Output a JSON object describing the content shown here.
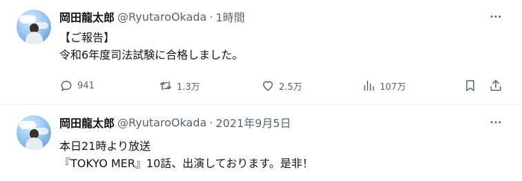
{
  "tweets": [
    {
      "name": "岡田龍太郎",
      "handle": "@RyutaroOkada",
      "separator": "·",
      "time": "1時間",
      "lines": [
        "【ご報告】",
        "令和6年度司法試験に合格しました。"
      ],
      "stats": {
        "replies": "941",
        "retweets": "1.3万",
        "likes": "2.5万",
        "views": "107万"
      }
    },
    {
      "name": "岡田龍太郎",
      "handle": "@RyutaroOkada",
      "separator": "·",
      "time": "2021年9月5日",
      "lines": [
        "本日21時より放送",
        "『TOKYO MER』10話、出演しております。是非！"
      ]
    }
  ],
  "icons": {
    "more": "more-horizontal-icon",
    "reply": "reply-icon",
    "retweet": "retweet-icon",
    "like": "heart-icon",
    "views": "views-icon",
    "bookmark": "bookmark-icon",
    "share": "share-icon"
  },
  "colors": {
    "text": "#0f1419",
    "secondary": "#536471",
    "divider": "#eff3f4"
  }
}
